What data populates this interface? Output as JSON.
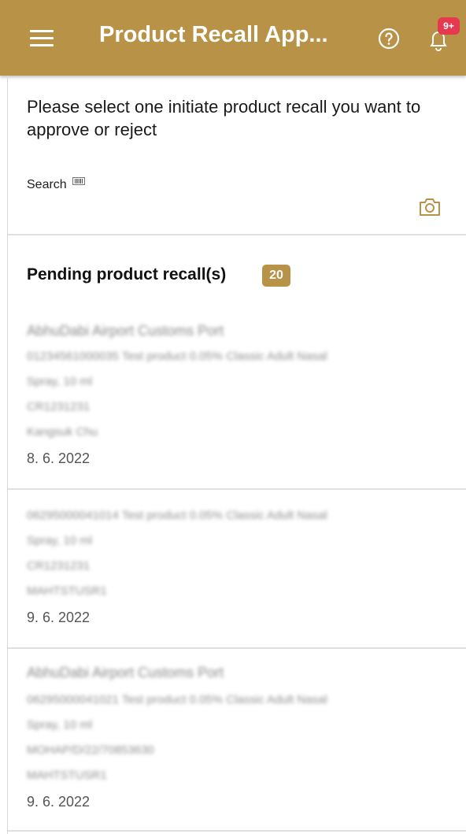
{
  "header": {
    "title": "Product Recall App...",
    "notification_badge": "9+",
    "color": "#b89247"
  },
  "instruction": "Please select one initiate product recall you want to approve or reject",
  "search": {
    "label": "Search"
  },
  "pending": {
    "title": "Pending product recall(s)",
    "count": "20"
  },
  "items": [
    {
      "port": "AbhuDabi Airport Customs Port",
      "product_line1": "01234561000035 Test product 0.05% Classic Adult Nasal",
      "product_line2": "Spray, 10 ml",
      "reference": "CR1231231",
      "user": "Kangsuk Chu",
      "date": "8. 6. 2022"
    },
    {
      "port": "",
      "product_line1": "06295000041014 Test product 0.05% Classic Adult Nasal",
      "product_line2": "Spray, 10 ml",
      "reference": "CR1231231",
      "user": "MAHTSTUSR1",
      "date": "9. 6. 2022"
    },
    {
      "port": "AbhuDabi Airport Customs Port",
      "product_line1": "06295000041021 Test product 0.05% Classic Adult Nasal",
      "product_line2": "Spray, 10 ml",
      "reference": "MOHAP/D/22/70853630",
      "user": "MAHTSTUSR1",
      "date": "9. 6. 2022"
    }
  ]
}
